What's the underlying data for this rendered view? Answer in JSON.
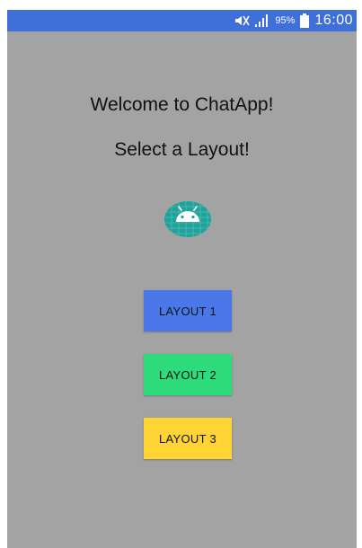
{
  "status_bar": {
    "battery_percent": "95%",
    "time": "16:00",
    "color": "#3f6fd8",
    "icons": [
      "mute-icon",
      "signal-icon",
      "battery-icon"
    ]
  },
  "screen": {
    "welcome_text": "Welcome to ChatApp!",
    "select_text": "Select a Layout!",
    "background": "#a3a3a3",
    "logo_icon": "android-icon"
  },
  "buttons": [
    {
      "label": "LAYOUT 1",
      "color": "#4a78e8"
    },
    {
      "label": "LAYOUT 2",
      "color": "#2ddb7a"
    },
    {
      "label": "LAYOUT 3",
      "color": "#ffd433"
    }
  ]
}
